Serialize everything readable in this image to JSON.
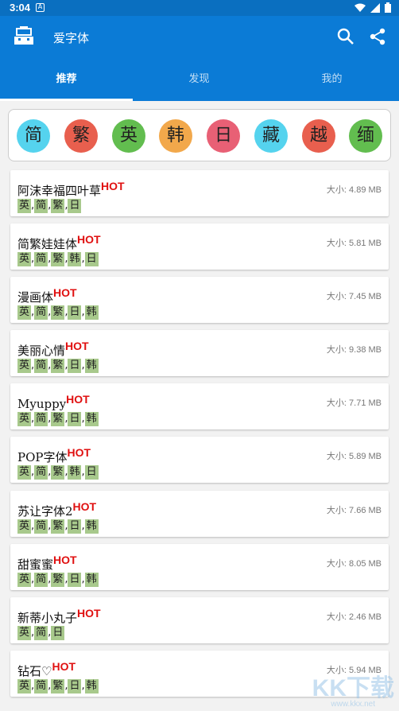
{
  "status_bar": {
    "time": "3:04",
    "notif_glyph": "A"
  },
  "app_bar": {
    "title": "爱字体"
  },
  "tabs": [
    {
      "label": "推荐",
      "active": true
    },
    {
      "label": "发现",
      "active": false
    },
    {
      "label": "我的",
      "active": false
    }
  ],
  "language_filters": [
    {
      "label": "简",
      "color": "#55d3ee"
    },
    {
      "label": "繁",
      "color": "#e85f4e"
    },
    {
      "label": "英",
      "color": "#62bd4f"
    },
    {
      "label": "韩",
      "color": "#f2a84b"
    },
    {
      "label": "日",
      "color": "#e86075"
    },
    {
      "label": "藏",
      "color": "#55d3ee"
    },
    {
      "label": "越",
      "color": "#e85f4e"
    },
    {
      "label": "缅",
      "color": "#62bd4f"
    }
  ],
  "font_list": [
    {
      "name": "阿沫幸福四叶草",
      "badge": "HOT",
      "size": "大小: 4.89 MB",
      "tags": [
        "英",
        "简",
        "繁",
        "日"
      ]
    },
    {
      "name": "简繁娃娃体",
      "badge": "HOT",
      "size": "大小: 5.81 MB",
      "tags": [
        "英",
        "简",
        "繁",
        "韩",
        "日"
      ]
    },
    {
      "name": "漫画体",
      "badge": "HOT",
      "size": "大小: 7.45 MB",
      "tags": [
        "英",
        "简",
        "繁",
        "日",
        "韩"
      ]
    },
    {
      "name": "美丽心情",
      "badge": "HOT",
      "size": "大小: 9.38 MB",
      "tags": [
        "英",
        "简",
        "繁",
        "日",
        "韩"
      ]
    },
    {
      "name": "Myuppy",
      "badge": "HOT",
      "size": "大小: 7.71 MB",
      "tags": [
        "英",
        "简",
        "繁",
        "日",
        "韩"
      ]
    },
    {
      "name": "POP字体",
      "badge": "HOT",
      "size": "大小: 5.89 MB",
      "tags": [
        "英",
        "简",
        "繁",
        "韩",
        "日"
      ]
    },
    {
      "name": "苏让字体2",
      "badge": "HOT",
      "size": "大小: 7.66 MB",
      "tags": [
        "英",
        "简",
        "繁",
        "日",
        "韩"
      ]
    },
    {
      "name": "甜蜜蜜",
      "badge": "HOT",
      "size": "大小: 8.05 MB",
      "tags": [
        "英",
        "简",
        "繁",
        "日",
        "韩"
      ]
    },
    {
      "name": "新蒂小丸子",
      "badge": "HOT",
      "size": "大小: 2.46 MB",
      "tags": [
        "英",
        "简",
        "日"
      ]
    },
    {
      "name": "钻石♡",
      "badge": "HOT",
      "size": "大小: 5.94 MB",
      "tags": [
        "英",
        "简",
        "繁",
        "日",
        "韩"
      ]
    }
  ],
  "watermark": {
    "logo_text": "KK下载",
    "url": "www.kkx.net"
  }
}
